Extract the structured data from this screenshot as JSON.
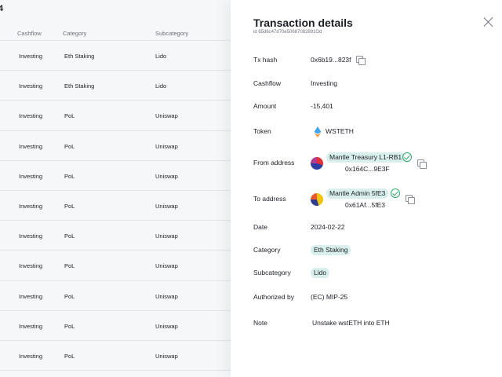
{
  "background": {
    "title_fragment": "4",
    "columns": [
      "Cashflow",
      "Category",
      "Subcategory"
    ],
    "rows": [
      {
        "cashflow": "Investing",
        "category": "Eth Staking",
        "subcategory": "Lido"
      },
      {
        "cashflow": "Investing",
        "category": "Eth Staking",
        "subcategory": "Lido"
      },
      {
        "cashflow": "Investing",
        "category": "PoL",
        "subcategory": "Uniswap"
      },
      {
        "cashflow": "Investing",
        "category": "PoL",
        "subcategory": "Uniswap"
      },
      {
        "cashflow": "Investing",
        "category": "PoL",
        "subcategory": "Uniswap"
      },
      {
        "cashflow": "Investing",
        "category": "PoL",
        "subcategory": "Uniswap"
      },
      {
        "cashflow": "Investing",
        "category": "PoL",
        "subcategory": "Uniswap"
      },
      {
        "cashflow": "Investing",
        "category": "PoL",
        "subcategory": "Uniswap"
      },
      {
        "cashflow": "Investing",
        "category": "PoL",
        "subcategory": "Uniswap"
      },
      {
        "cashflow": "Investing",
        "category": "PoL",
        "subcategory": "Uniswap"
      },
      {
        "cashflow": "Investing",
        "category": "PoL",
        "subcategory": "Uniswap"
      }
    ]
  },
  "drawer": {
    "title": "Transaction details",
    "id_text": "id 65d6c47d70e50687082891Od",
    "fields": {
      "tx_hash": {
        "label": "Tx hash",
        "value": "0x6b19...823f"
      },
      "cashflow": {
        "label": "Cashflow",
        "value": "Investing"
      },
      "amount": {
        "label": "Amount",
        "value": "-15,401"
      },
      "token": {
        "label": "Token",
        "value": "WSTETH"
      },
      "from": {
        "label": "From address",
        "name": "Mantle Treasury L1-RB1",
        "address": "0x164C...9E3F"
      },
      "to": {
        "label": "To address",
        "name": "Mantle Admin 5fE3",
        "address": "0x61Af...5fE3"
      },
      "date": {
        "label": "Date",
        "value": "2024-02-22"
      },
      "category": {
        "label": "Category",
        "value": "Eth Staking"
      },
      "subcategory": {
        "label": "Subcategory",
        "value": "Lido"
      },
      "authorized_by": {
        "label": "Authorized by",
        "value": "(EC) MIP-25"
      },
      "note": {
        "label": "Note",
        "value": "Unstake wstETH into ETH"
      }
    }
  },
  "icons": [
    "close-icon",
    "copy-icon",
    "verified-check-icon",
    "wsteth-token-icon",
    "avatar"
  ],
  "colors": {
    "tag_bg": "#d9efec",
    "check_green": "#2faa6a",
    "text": "#1c1f26",
    "muted": "#6b717c"
  }
}
